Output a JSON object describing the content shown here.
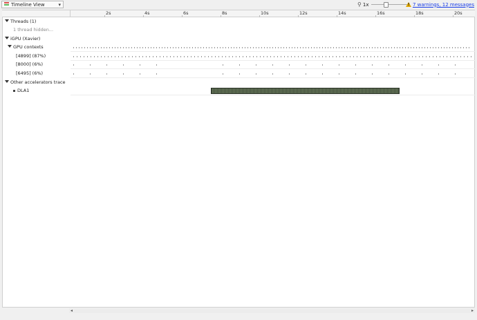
{
  "toolbar": {
    "view_label": "Timeline View",
    "zoom_value": "1x",
    "zoom_level": 0.35,
    "warnings_text": "7 warnings, 12 messages"
  },
  "ruler": {
    "ticks": [
      "2s",
      "4s",
      "6s",
      "8s",
      "10s",
      "12s",
      "14s",
      "16s",
      "18s",
      "20s"
    ]
  },
  "tree": {
    "threads": "Threads (1)",
    "threads_hidden": "1 thread hidden...",
    "igpu": "iGPU (Xavier)",
    "gpu_contexts": "GPU contexts",
    "ctx1": "[4899] (87%)",
    "ctx2": "[8000] (6%)",
    "ctx3": "[6495] (6%)",
    "other_acc": "Other accelerators trace",
    "dla1": "DLA1"
  },
  "colors": {
    "accent_link": "#1a3ee8",
    "dla_bar": "#3c4a38",
    "warning": "#e0a800"
  }
}
